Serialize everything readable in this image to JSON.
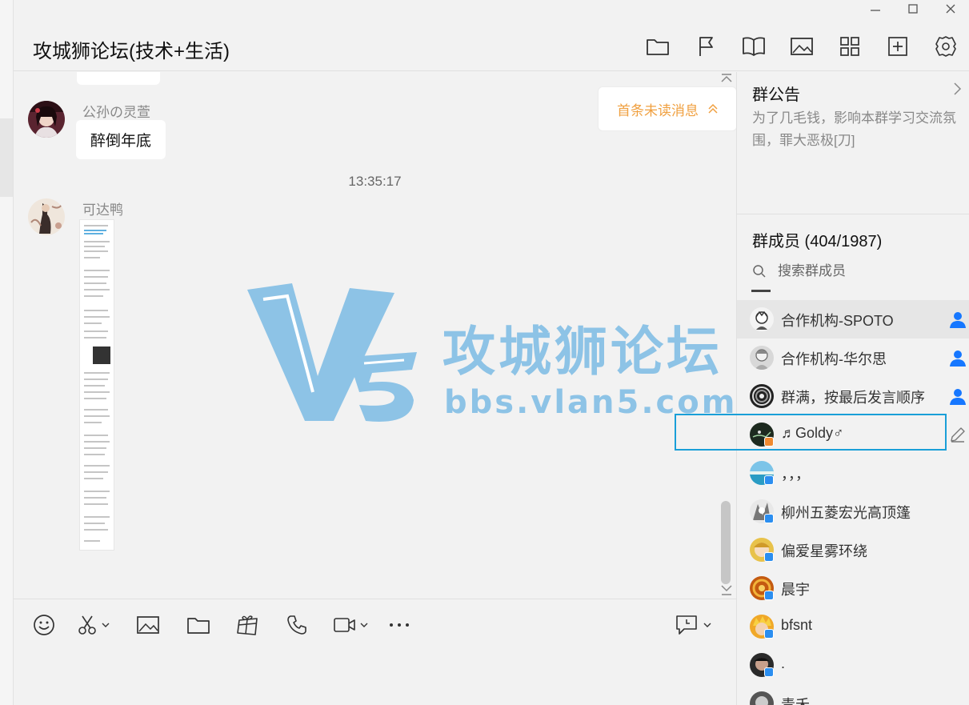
{
  "window": {
    "title": "攻城狮论坛(技术+生活)",
    "controls": [
      "minimize-icon",
      "maximize-icon",
      "close-icon"
    ]
  },
  "toolbar": {
    "icons": [
      "folder-icon",
      "flag-icon",
      "book-icon",
      "image-icon",
      "apps-grid-icon",
      "add-app-icon",
      "settings-icon"
    ]
  },
  "chat": {
    "messages": [
      {
        "sender": "公孙の灵萱",
        "text": "醉倒年底"
      },
      {
        "sender": "可达鸭",
        "type": "image"
      }
    ],
    "timestamp": "13:35:17",
    "unread_button": "首条未读消息"
  },
  "watermark": {
    "logo": "V5",
    "title": "攻城狮论坛",
    "url": "bbs.vlan5.com"
  },
  "compose": {
    "tools": [
      "emoji-icon",
      "scissors-icon",
      "image-icon",
      "folder-icon",
      "gift-icon",
      "phone-icon",
      "video-icon",
      "more-icon"
    ],
    "right_tool": "chat-history-icon"
  },
  "notice": {
    "title": "群公告",
    "body": "为了几毛钱，影响本群学习交流氛围，罪大恶极[刀]"
  },
  "members": {
    "title": "群成员 (404/1987)",
    "search_placeholder": "搜索群成员",
    "list": [
      {
        "name": "合作机构-SPOTO",
        "role": "admin"
      },
      {
        "name": "合作机构-华尔思",
        "role": "admin"
      },
      {
        "name": "群满，按最后发言顺序踢",
        "role": "admin"
      },
      {
        "name": "♬Goldy♂",
        "role": "self"
      },
      {
        "name": "，，，",
        "role": ""
      },
      {
        "name": "柳州五菱宏光高顶篷",
        "role": ""
      },
      {
        "name": "偏爱星雾环绕",
        "role": ""
      },
      {
        "name": "晨宇",
        "role": ""
      },
      {
        "name": "bfsnt",
        "role": ""
      },
      {
        "name": ".",
        "role": ""
      },
      {
        "name": "青禾",
        "role": ""
      }
    ]
  },
  "colors": {
    "accent_orange": "#f0a040",
    "admin_blue": "#1677ff",
    "selection_blue": "#1a9fd8",
    "watermark_blue": "#8dc3e6"
  }
}
